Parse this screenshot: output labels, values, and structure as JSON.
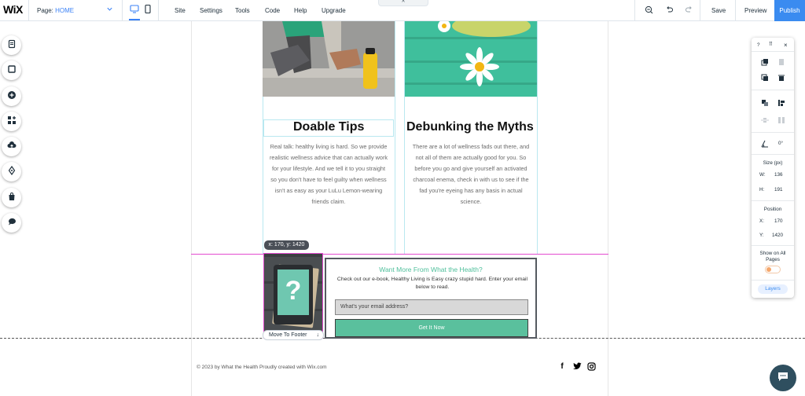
{
  "topbar": {
    "page_label": "Page:",
    "page_value": "HOME",
    "menu": [
      "Site",
      "Settings",
      "Tools",
      "Code",
      "Help",
      "Upgrade"
    ],
    "save_label": "Save",
    "preview_label": "Preview",
    "publish_label": "Publish",
    "notch_glyph": "^",
    "accent_color": "#3a8bf0"
  },
  "logo": "WiX",
  "left_rail": {
    "icons": [
      "pages-icon",
      "background-icon",
      "add-icon",
      "app-market-icon",
      "media-upload-icon",
      "blog-icon",
      "store-icon",
      "chat-icon"
    ]
  },
  "content": {
    "card1": {
      "title": "Doable Tips",
      "body": "Real talk: healthy living is hard. So we provide realistic wellness advice that can actually work for your lifestyle. And we tell it to you straight so you don't have to feel guilty when wellness isn't as easy as your LuLu Lemon-wearing friends claim."
    },
    "card2": {
      "title": "Debunking the Myths",
      "body": "There are a lot of wellness fads out there, and not all of them are actually good for you. So before you go and give yourself an activated charcoal enema, check in with us to see if the fad you're eyeing has any basis in actual science."
    }
  },
  "selection": {
    "coord_tag": "x: 170, y: 1420",
    "move_to_footer": "Move To Footer",
    "move_arrow": "↓"
  },
  "subscribe": {
    "title": "Want More From What the Health?",
    "description": "Check out our e-book, Healthy Living is Easy crazy stupid hard. Enter your email below to read.",
    "email_placeholder": "What's your email address?",
    "button_label": "Get It Now",
    "accent_color": "#5ac09d"
  },
  "footer": {
    "copyright": "© 2023 by What the Health Proudly created with Wix.com",
    "social": [
      "f",
      "twitter-icon",
      "instagram-icon"
    ]
  },
  "panel": {
    "help": "?",
    "drag": "⠿",
    "close": "×",
    "rotation_value": "0°",
    "size_label": "Size (px)",
    "width_label": "W:",
    "width_value": "136",
    "height_label": "H:",
    "height_value": "191",
    "position_label": "Position",
    "x_label": "X:",
    "x_value": "170",
    "y_label": "Y:",
    "y_value": "1420",
    "show_all_label": "Show on All Pages",
    "show_all_on": false,
    "layers_label": "Layers"
  }
}
